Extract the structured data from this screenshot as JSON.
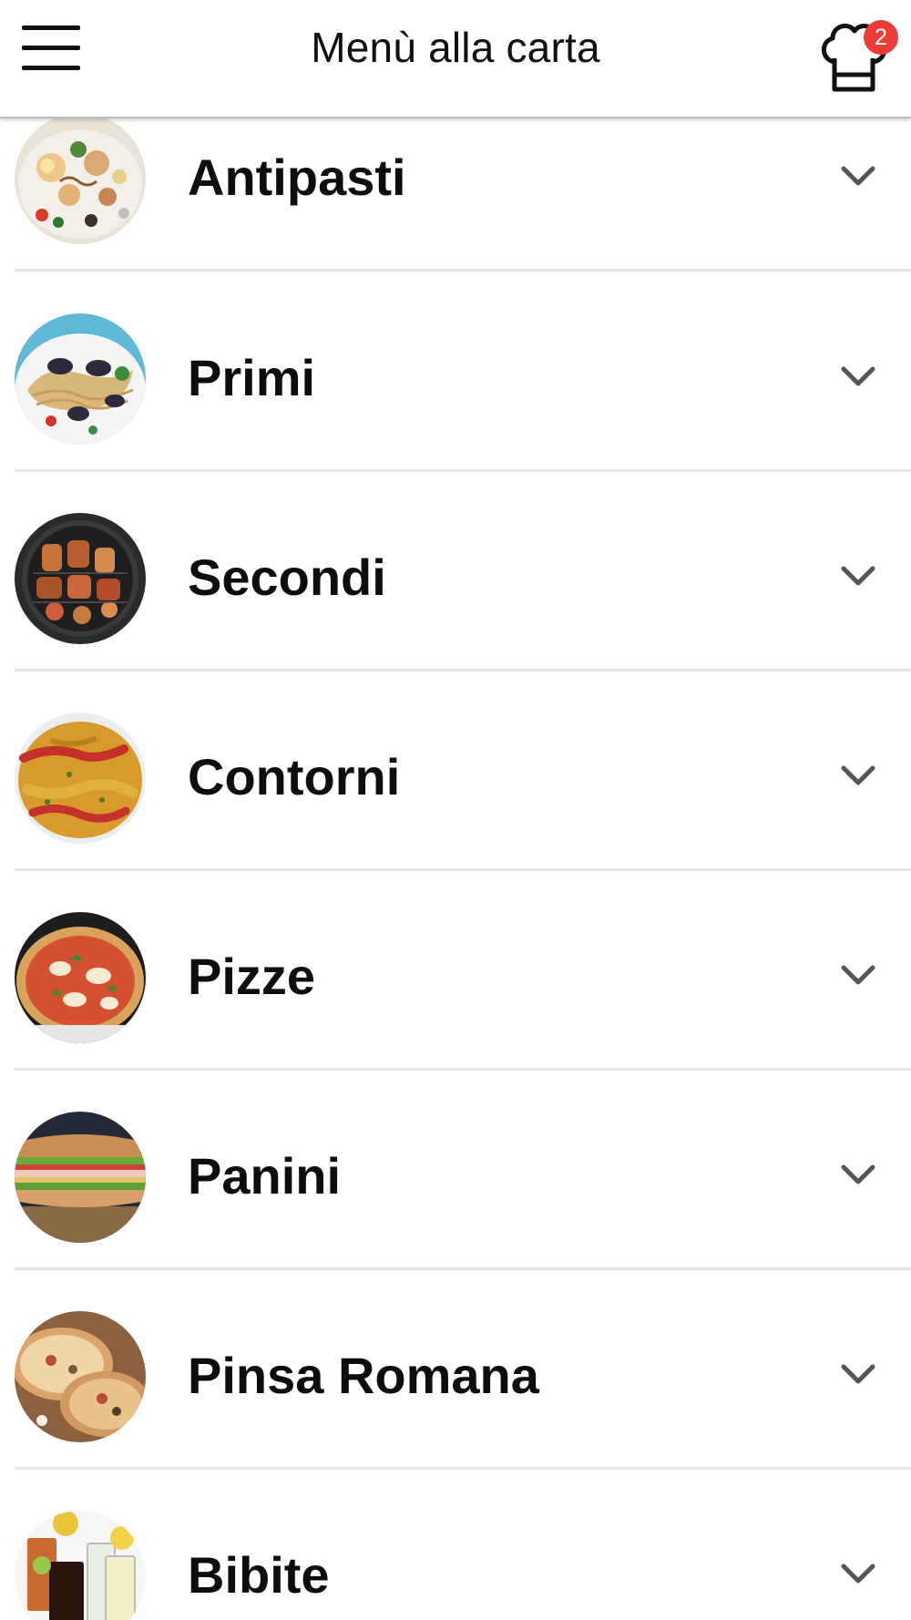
{
  "header": {
    "title": "Menù alla carta",
    "cart_count": "2",
    "menu_icon": "hamburger-icon",
    "cart_icon": "chef-hat-icon"
  },
  "categories": [
    {
      "label": "Antipasti",
      "image": "seafood-platter"
    },
    {
      "label": "Primi",
      "image": "seafood-pasta"
    },
    {
      "label": "Secondi",
      "image": "grilled-meats"
    },
    {
      "label": "Contorni",
      "image": "roasted-peppers"
    },
    {
      "label": "Pizze",
      "image": "margherita-pizza"
    },
    {
      "label": "Panini",
      "image": "sandwich"
    },
    {
      "label": "Pinsa Romana",
      "image": "pinsa"
    },
    {
      "label": "Bibite",
      "image": "drinks"
    }
  ],
  "colors": {
    "badge": "#ef3b36",
    "divider": "#e3e3e3",
    "chevron": "#555555"
  }
}
